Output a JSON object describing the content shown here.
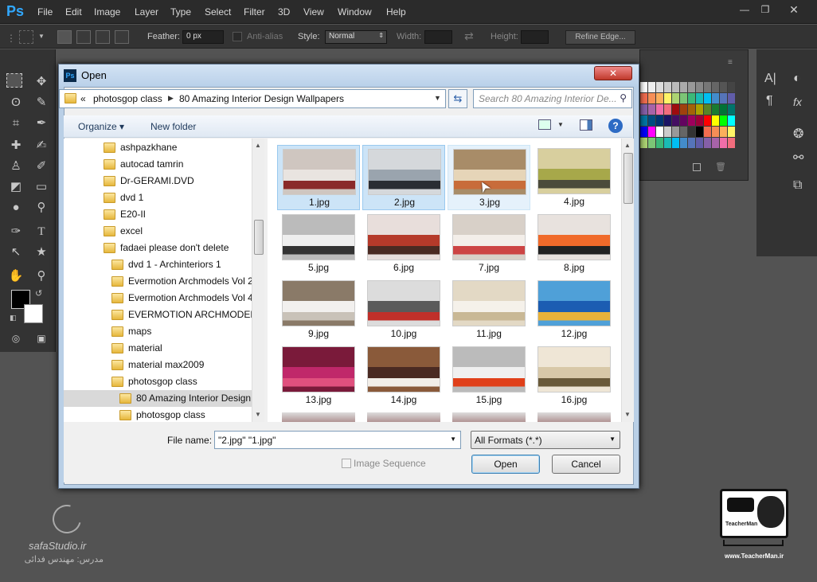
{
  "app": {
    "logo": "Ps",
    "menus": [
      "File",
      "Edit",
      "Image",
      "Layer",
      "Type",
      "Select",
      "Filter",
      "3D",
      "View",
      "Window",
      "Help"
    ]
  },
  "options": {
    "feather_label": "Feather:",
    "feather_value": "0 px",
    "antialias_label": "Anti-alias",
    "style_label": "Style:",
    "style_value": "Normal",
    "width_label": "Width:",
    "height_label": "Height:",
    "refine_edge": "Refine Edge..."
  },
  "dialog": {
    "title": "Open",
    "breadcrumb": [
      "«",
      "photosgop class",
      "80 Amazing Interior Design Wallpapers"
    ],
    "search_placeholder": "Search 80 Amazing Interior De...",
    "organize": "Organize",
    "new_folder": "New folder",
    "folders": [
      {
        "name": "ashpazkhane",
        "indent": 0
      },
      {
        "name": "autocad tamrin",
        "indent": 0
      },
      {
        "name": "Dr-GERAMI.DVD",
        "indent": 0
      },
      {
        "name": "dvd 1",
        "indent": 0
      },
      {
        "name": "E20-II",
        "indent": 0
      },
      {
        "name": "excel",
        "indent": 0
      },
      {
        "name": "fadaei please don't delete",
        "indent": 0
      },
      {
        "name": "dvd 1 - Archinteriors 1",
        "indent": 1
      },
      {
        "name": "Evermotion Archmodels Vol 2",
        "indent": 1
      },
      {
        "name": "Evermotion Archmodels Vol 4",
        "indent": 1
      },
      {
        "name": "EVERMOTION ARCHMODELS",
        "indent": 1
      },
      {
        "name": "maps",
        "indent": 1
      },
      {
        "name": "material",
        "indent": 1
      },
      {
        "name": "material max2009",
        "indent": 1
      },
      {
        "name": "photosgop class",
        "indent": 1
      },
      {
        "name": "80 Amazing Interior Design",
        "indent": 2,
        "selected": true
      },
      {
        "name": "photosgop class",
        "indent": 2
      }
    ],
    "files": [
      "1.jpg",
      "2.jpg",
      "3.jpg",
      "4.jpg",
      "5.jpg",
      "6.jpg",
      "7.jpg",
      "8.jpg",
      "9.jpg",
      "10.jpg",
      "11.jpg",
      "12.jpg",
      "13.jpg",
      "14.jpg",
      "15.jpg",
      "16.jpg"
    ],
    "selected_files": [
      "1.jpg",
      "2.jpg"
    ],
    "hovered_file": "3.jpg",
    "filename_label": "File name:",
    "filename_value": "\"2.jpg\" \"1.jpg\"",
    "format_value": "All Formats (*.*)",
    "image_sequence": "Image Sequence",
    "open_button": "Open",
    "cancel_button": "Cancel"
  },
  "watermark": {
    "left_site": "safaStudio.ir",
    "left_teacher": "مدرس: مهندس فدائی",
    "right_site": "www.TeacherMan.ir",
    "right_brand": "TeacherMan"
  },
  "colors": {
    "ps_bg": "#535353",
    "selection": "#cce4f7",
    "accent": "#31a8ff"
  }
}
